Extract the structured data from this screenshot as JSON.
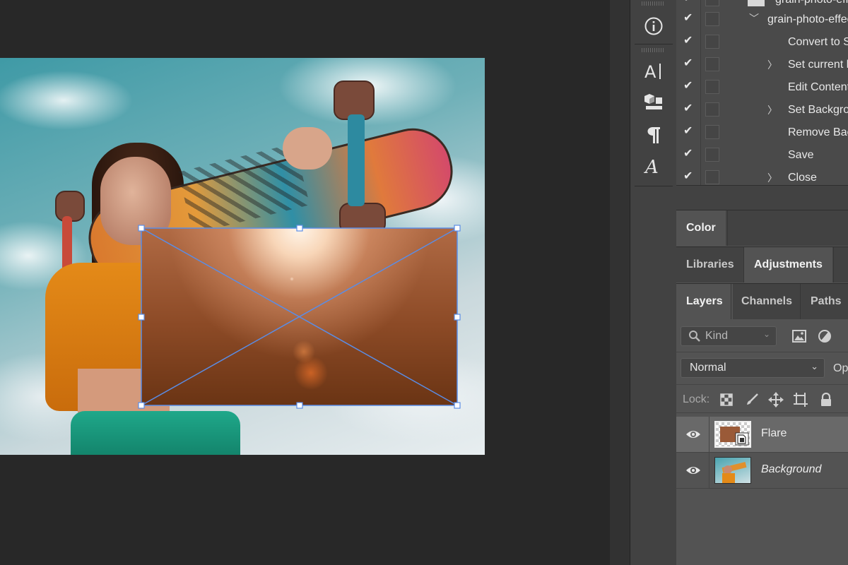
{
  "canvas": {
    "layer_flare": "Flare"
  },
  "actions": {
    "items": [
      {
        "label": "grain-photo-effect",
        "checked": true,
        "expandable": false,
        "state": "set-top"
      },
      {
        "label": "grain-photo-effect",
        "checked": true,
        "expandable": true,
        "state": "open"
      },
      {
        "label": "Convert to S",
        "checked": true,
        "expandable": false
      },
      {
        "label": "Set current l",
        "checked": true,
        "expandable": true
      },
      {
        "label": "Edit Content",
        "checked": true,
        "expandable": false
      },
      {
        "label": "Set Backgro",
        "checked": true,
        "expandable": true
      },
      {
        "label": "Remove Bac",
        "checked": true,
        "expandable": false
      },
      {
        "label": "Save",
        "checked": true,
        "expandable": false
      },
      {
        "label": "Close",
        "checked": true,
        "expandable": true
      }
    ]
  },
  "panel_tabs": {
    "color": "Color",
    "libraries": "Libraries",
    "adjustments": "Adjustments",
    "layers": "Layers",
    "channels": "Channels",
    "paths": "Paths"
  },
  "layers_panel": {
    "filter_placeholder": "Kind",
    "blend_mode": "Normal",
    "opacity_label": "Op",
    "lock_label": "Lock:",
    "layers": [
      {
        "name": "Flare",
        "selected": true,
        "italic": false,
        "visible": true
      },
      {
        "name": "Background",
        "selected": false,
        "italic": true,
        "visible": true
      }
    ]
  },
  "icons": {
    "strip": [
      "info-icon",
      "character-icon",
      "3d-object-icon",
      "paragraph-icon",
      "glyphs-icon"
    ],
    "filters": [
      "image-filter-icon",
      "adjustment-filter-icon"
    ],
    "locks": [
      "lock-transparent-icon",
      "lock-brush-icon",
      "lock-move-icon",
      "lock-artboard-icon",
      "lock-all-icon"
    ]
  },
  "colors": {
    "app_bg": "#282828",
    "panel_bg": "#535353",
    "selected_layer": "#696969",
    "transform_outline": "#5a8de6"
  }
}
